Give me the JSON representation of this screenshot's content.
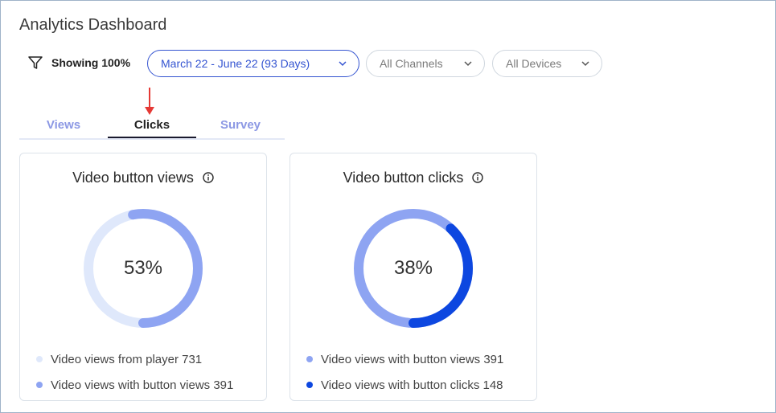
{
  "header": {
    "title": "Analytics Dashboard"
  },
  "filters": {
    "showing_label": "Showing 100%",
    "date_range": "March 22 - June 22 (93 Days)",
    "channels": "All Channels",
    "devices": "All Devices"
  },
  "tabs": [
    {
      "label": "Views"
    },
    {
      "label": "Clicks"
    },
    {
      "label": "Survey"
    }
  ],
  "colors": {
    "primary": "#3454d1",
    "donut_light": "#dfe8fb",
    "donut_mid": "#8ea4f2",
    "donut_dark": "#0d47e0",
    "arrow": "#e53935"
  },
  "cards": [
    {
      "title": "Video button views",
      "percent_label": "53%",
      "percent": 0.53,
      "legend": [
        {
          "label": "Video views from player 731",
          "color": "#dfe8fb"
        },
        {
          "label": "Video views with button views 391",
          "color": "#8ea4f2"
        }
      ]
    },
    {
      "title": "Video button clicks",
      "percent_label": "38%",
      "percent": 0.38,
      "legend": [
        {
          "label": "Video views with button views 391",
          "color": "#8ea4f2"
        },
        {
          "label": "Video views with button clicks 148",
          "color": "#0d47e0"
        }
      ]
    }
  ]
}
